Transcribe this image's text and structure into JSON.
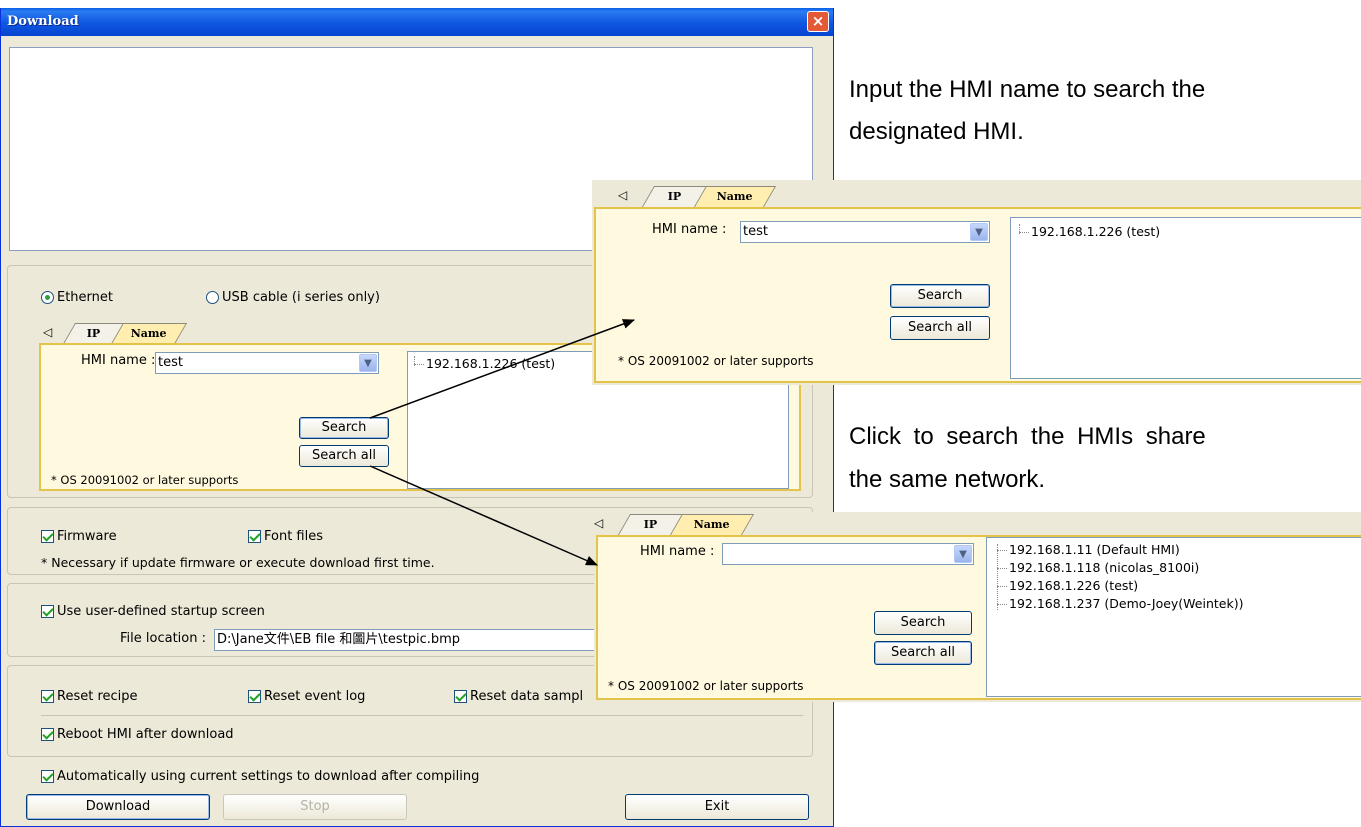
{
  "window": {
    "title": "Download",
    "close_glyph": "×"
  },
  "connection": {
    "ethernet_label": "Ethernet",
    "usb_label": "USB cable (i series only)",
    "selected": "ethernet"
  },
  "tabs": {
    "ip_label": "IP",
    "name_label": "Name",
    "scroll_glyph": "◁"
  },
  "main_panel": {
    "hmi_name_label": "HMI name :",
    "hmi_name_value": "test",
    "search_label": "Search",
    "search_all_label": "Search all",
    "os_note": "* OS 20091002 or later supports",
    "results": [
      "192.168.1.226 (test)"
    ]
  },
  "download_options": {
    "firmware_label": "Firmware",
    "font_files_label": "Font files",
    "note": "* Necessary if update firmware or execute download first time.",
    "startup_label": "Use user-defined startup screen",
    "file_location_label": "File location :",
    "file_location_value": "D:\\Jane文件\\EB file 和圖片\\testpic.bmp",
    "reset_recipe_label": "Reset recipe",
    "reset_event_log_label": "Reset event log",
    "reset_data_sampling_label": "Reset data sampl",
    "reboot_label": "Reboot HMI after download",
    "auto_label": "Automatically using current settings to download after compiling"
  },
  "footer_buttons": {
    "download_label": "Download",
    "stop_label": "Stop",
    "exit_label": "Exit"
  },
  "callout_top": {
    "hmi_name_label": "HMI name :",
    "hmi_name_value": "test",
    "search_label": "Search",
    "search_all_label": "Search all",
    "os_note": "* OS 20091002 or later supports",
    "results": [
      "192.168.1.226 (test)"
    ]
  },
  "callout_bottom": {
    "hmi_name_label": "HMI name :",
    "hmi_name_value": "",
    "search_label": "Search",
    "search_all_label": "Search all",
    "os_note": "* OS 20091002 or later supports",
    "results": [
      "192.168.1.11 (Default HMI)",
      "192.168.1.118 (nicolas_8100i)",
      "192.168.1.226 (test)",
      "192.168.1.237 (Demo-Joey(Weintek))"
    ]
  },
  "captions": {
    "name_line1": "Input the HMI name to search the",
    "name_line2": "designated HMI.",
    "all_line1": "Click to search the HMIs share",
    "all_line2": "the same network."
  },
  "colors": {
    "titlebar": "#0a5fe8",
    "dialog_bg": "#ece9d8",
    "name_panel_bg": "#fffadf",
    "name_panel_border": "#e4c34a"
  }
}
